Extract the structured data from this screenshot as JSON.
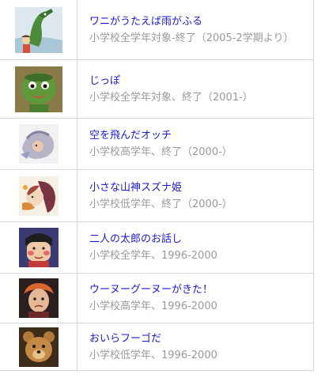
{
  "programs": [
    {
      "title": "ワニがうたえば雨がふる",
      "detail": "小学校全学年対象-終了（2005-2学期より）",
      "icon": "crocodile-thumbnail-icon"
    },
    {
      "title": "じっぽ",
      "detail": "小学校全学年対象、終了（2001-）",
      "icon": "kappa-thumbnail-icon"
    },
    {
      "title": "空を飛んだオッチ",
      "detail": "小学校高学年、終了（2000-）",
      "icon": "bird-thumbnail-icon"
    },
    {
      "title": "小さな山神スズナ姫",
      "detail": "小学校低学年、終了（2000-）",
      "icon": "princess-thumbnail-icon"
    },
    {
      "title": "二人の太郎のお話し",
      "detail": "小学校全学年、1996-2000",
      "icon": "taro-thumbnail-icon"
    },
    {
      "title": "ウーヌーグーヌーがきた！",
      "detail": "小学校高学年、1996-2000",
      "icon": "unu-thumbnail-icon"
    },
    {
      "title": "おいらフーゴだ",
      "detail": "小学校低学年、1996-2000",
      "icon": "bear-thumbnail-icon"
    }
  ]
}
